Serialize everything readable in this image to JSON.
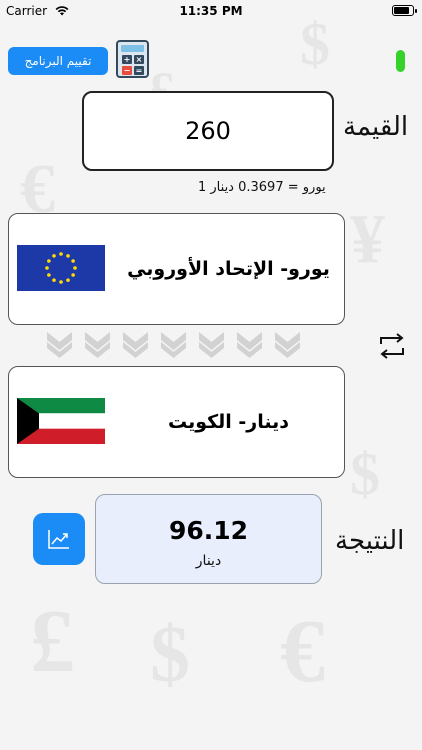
{
  "status": {
    "carrier": "Carrier",
    "time": "11:35 PM",
    "battery_level": 0.9
  },
  "header": {
    "rate_app_label": "تقييم البرنامج"
  },
  "value": {
    "label": "القيمة",
    "amount": "260"
  },
  "rate": {
    "text": "1 يورو = 0.3697 دينار"
  },
  "from_currency": {
    "name": "يورو- الإتحاد الأوروبي",
    "flag": "eu-flag"
  },
  "to_currency": {
    "name": "دينار- الكويت",
    "flag": "kuwait-flag"
  },
  "result": {
    "label": "النتيجة",
    "value": "96.12",
    "unit": "دينار"
  },
  "colors": {
    "accent": "#1b8bf5",
    "status_green": "#36d12b",
    "result_bg": "#e8eefb"
  }
}
